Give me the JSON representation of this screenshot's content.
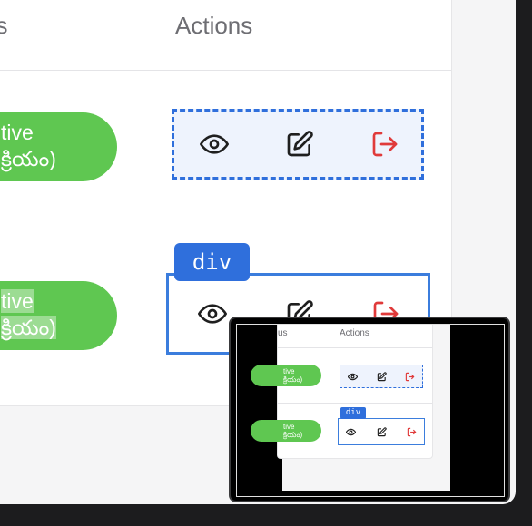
{
  "table": {
    "headers": {
      "status": "us",
      "actions": "Actions"
    },
    "rows": [
      {
        "status_line1": "tive",
        "status_line2": "క్రియం)",
        "tag": ""
      },
      {
        "status_line1": "tive",
        "status_line2": "క్రియం)",
        "tag": "div"
      }
    ]
  },
  "icons": {
    "view": "eye-icon",
    "edit": "edit-icon",
    "logout": "logout-icon"
  },
  "colors": {
    "badge": "#5fc751",
    "highlight": "#2f6fdc",
    "logout_icon": "#e03a3a",
    "icon": "#1f1f1f"
  },
  "minimap": {
    "headers": {
      "status": "us",
      "actions": "Actions"
    },
    "rows": [
      {
        "status_line1": "tive",
        "status_line2": "క్రియం)"
      },
      {
        "status_line1": "tive",
        "status_line2": "క్రియం)"
      }
    ],
    "tag": "div"
  }
}
